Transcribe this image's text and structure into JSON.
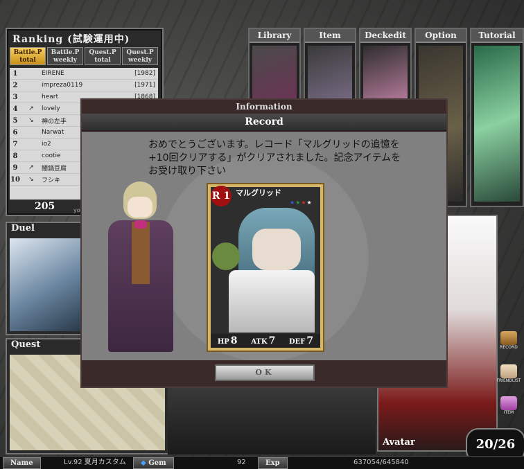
{
  "ranking": {
    "title": "Ranking (試験運用中)",
    "tabs": [
      "Battle.P total",
      "Battle.P weekly",
      "Quest.P total",
      "Quest.P weekly"
    ],
    "rows": [
      {
        "rank": "1",
        "arrow": "",
        "name": "EIRENE",
        "score": "[1982]"
      },
      {
        "rank": "2",
        "arrow": "",
        "name": "impreza0119",
        "score": "[1971]"
      },
      {
        "rank": "3",
        "arrow": "",
        "name": "heart",
        "score": "[1868]"
      },
      {
        "rank": "4",
        "arrow": "↗",
        "name": "lovely",
        "score": ""
      },
      {
        "rank": "5",
        "arrow": "↘",
        "name": "神の左手",
        "score": ""
      },
      {
        "rank": "6",
        "arrow": "",
        "name": "Narwat",
        "score": ""
      },
      {
        "rank": "7",
        "arrow": "",
        "name": "io2",
        "score": ""
      },
      {
        "rank": "8",
        "arrow": "",
        "name": "cootie",
        "score": ""
      },
      {
        "rank": "9",
        "arrow": "↗",
        "name": "闇鍋豆腐",
        "score": ""
      },
      {
        "rank": "10",
        "arrow": "↘",
        "name": "フシキ",
        "score": ""
      }
    ],
    "your_rank": "205",
    "your_label": "your"
  },
  "menu": [
    "Library",
    "Item",
    "Deckedit",
    "Option",
    "Tutorial"
  ],
  "panels": {
    "duel": "Duel",
    "quest": "Quest",
    "avatar": "Avatar"
  },
  "modal": {
    "header": "Information",
    "title": "Record",
    "message": "おめでとうございます。レコード「マルグリッドの追憶を\n+10回クリアする」がクリアされました。記念アイテムを\nお受け取り下さい",
    "card": {
      "rarity": "R",
      "level": "1",
      "name": "マルグリッド",
      "hp_label": "HP",
      "hp": "8",
      "atk_label": "ATK",
      "atk": "7",
      "def_label": "DEF",
      "def": "7"
    },
    "ok": "OK"
  },
  "side": [
    "RECORD",
    "FRIENDLIST",
    "ITEM"
  ],
  "counter": "20/26",
  "bottom": {
    "name_label": "Name",
    "name": "Lv.92 夏月カスタム",
    "gem_label": "Gem",
    "gem": "92",
    "exp_label": "Exp",
    "exp": "637054/645840"
  },
  "colors": {
    "modal_bg": "#2b1a1c",
    "rank_active_tab": "#e0b040",
    "card_frame": "#d6b76a"
  }
}
